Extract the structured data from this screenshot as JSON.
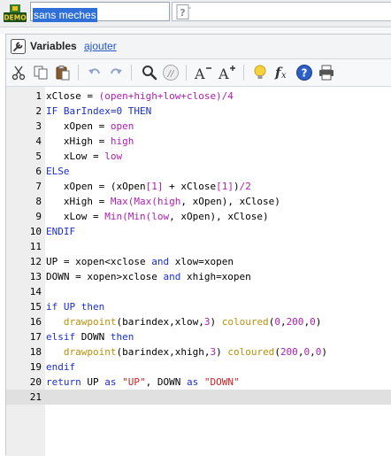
{
  "header": {
    "logo_text": "DEMO",
    "indicator_name": "sans meches"
  },
  "variables": {
    "title": "Variables",
    "add_link": "ajouter"
  },
  "editor": {
    "current_line": 21,
    "lines": [
      [
        [
          "pl",
          "xClose = "
        ],
        [
          "nm",
          "(open+high+low+close)/4"
        ]
      ],
      [
        [
          "kw",
          "IF BarIndex=0 THEN"
        ]
      ],
      [
        [
          "pl",
          "   xOpen = "
        ],
        [
          "nm",
          "open"
        ]
      ],
      [
        [
          "pl",
          "   xHigh = "
        ],
        [
          "nm",
          "high"
        ]
      ],
      [
        [
          "pl",
          "   xLow = "
        ],
        [
          "nm",
          "low"
        ]
      ],
      [
        [
          "kw",
          "ELSe"
        ]
      ],
      [
        [
          "pl",
          "   xOpen = (xOpen"
        ],
        [
          "nm",
          "[1]"
        ],
        [
          "pl",
          " + xClose"
        ],
        [
          "nm",
          "[1]"
        ],
        [
          "pl",
          ")"
        ],
        [
          "nm",
          "/2"
        ]
      ],
      [
        [
          "pl",
          "   xHigh = "
        ],
        [
          "nm",
          "Max(Max(high"
        ],
        [
          "pl",
          ", xOpen), xClose)"
        ]
      ],
      [
        [
          "pl",
          "   xLow = "
        ],
        [
          "nm",
          "Min(Min(low"
        ],
        [
          "pl",
          ", xOpen), xClose)"
        ]
      ],
      [
        [
          "kw",
          "ENDIF"
        ]
      ],
      [
        [
          "pl",
          ""
        ]
      ],
      [
        [
          "pl",
          "UP = xopen<xclose "
        ],
        [
          "kw",
          "and"
        ],
        [
          "pl",
          " xlow=xopen"
        ]
      ],
      [
        [
          "pl",
          "DOWN = xopen>xclose "
        ],
        [
          "kw",
          "and"
        ],
        [
          "pl",
          " xhigh=xopen"
        ]
      ],
      [
        [
          "pl",
          ""
        ]
      ],
      [
        [
          "kw",
          "if UP then"
        ]
      ],
      [
        [
          "pl",
          "   "
        ],
        [
          "fn",
          "drawpoint"
        ],
        [
          "pl",
          "(barindex,xlow,"
        ],
        [
          "nm",
          "3"
        ],
        [
          "pl",
          ") "
        ],
        [
          "fn",
          "coloured"
        ],
        [
          "pl",
          "("
        ],
        [
          "nm",
          "0"
        ],
        [
          "pl",
          ","
        ],
        [
          "nm",
          "200"
        ],
        [
          "pl",
          ","
        ],
        [
          "nm",
          "0"
        ],
        [
          "pl",
          ")"
        ]
      ],
      [
        [
          "kw",
          "elsif"
        ],
        [
          "pl",
          " DOWN "
        ],
        [
          "kw",
          "then"
        ]
      ],
      [
        [
          "pl",
          "   "
        ],
        [
          "fn",
          "drawpoint"
        ],
        [
          "pl",
          "(barindex,xhigh,"
        ],
        [
          "nm",
          "3"
        ],
        [
          "pl",
          ") "
        ],
        [
          "fn",
          "coloured"
        ],
        [
          "pl",
          "("
        ],
        [
          "nm",
          "200"
        ],
        [
          "pl",
          ","
        ],
        [
          "nm",
          "0"
        ],
        [
          "pl",
          ","
        ],
        [
          "nm",
          "0"
        ],
        [
          "pl",
          ")"
        ]
      ],
      [
        [
          "kw",
          "endif"
        ]
      ],
      [
        [
          "kw",
          "return"
        ],
        [
          "pl",
          " UP "
        ],
        [
          "kw",
          "as"
        ],
        [
          "pl",
          " "
        ],
        [
          "st",
          "\"UP\""
        ],
        [
          "pl",
          ", DOWN "
        ],
        [
          "kw",
          "as"
        ],
        [
          "pl",
          " "
        ],
        [
          "st",
          "\"DOWN\""
        ]
      ],
      [
        [
          "pl",
          ""
        ]
      ]
    ]
  },
  "colors": {
    "keyword": "#1a2fd0",
    "function": "#b8900a",
    "number_or_builtin": "#b020b0",
    "string": "#d02020",
    "selection": "#2f6fd8"
  },
  "toolbar_icons": [
    "cut-icon",
    "copy-icon",
    "paste-icon",
    "undo-icon",
    "redo-icon",
    "search-icon",
    "comment-icon",
    "decrease-font-icon",
    "increase-font-icon",
    "idea-icon",
    "function-icon",
    "help-icon",
    "print-icon"
  ]
}
